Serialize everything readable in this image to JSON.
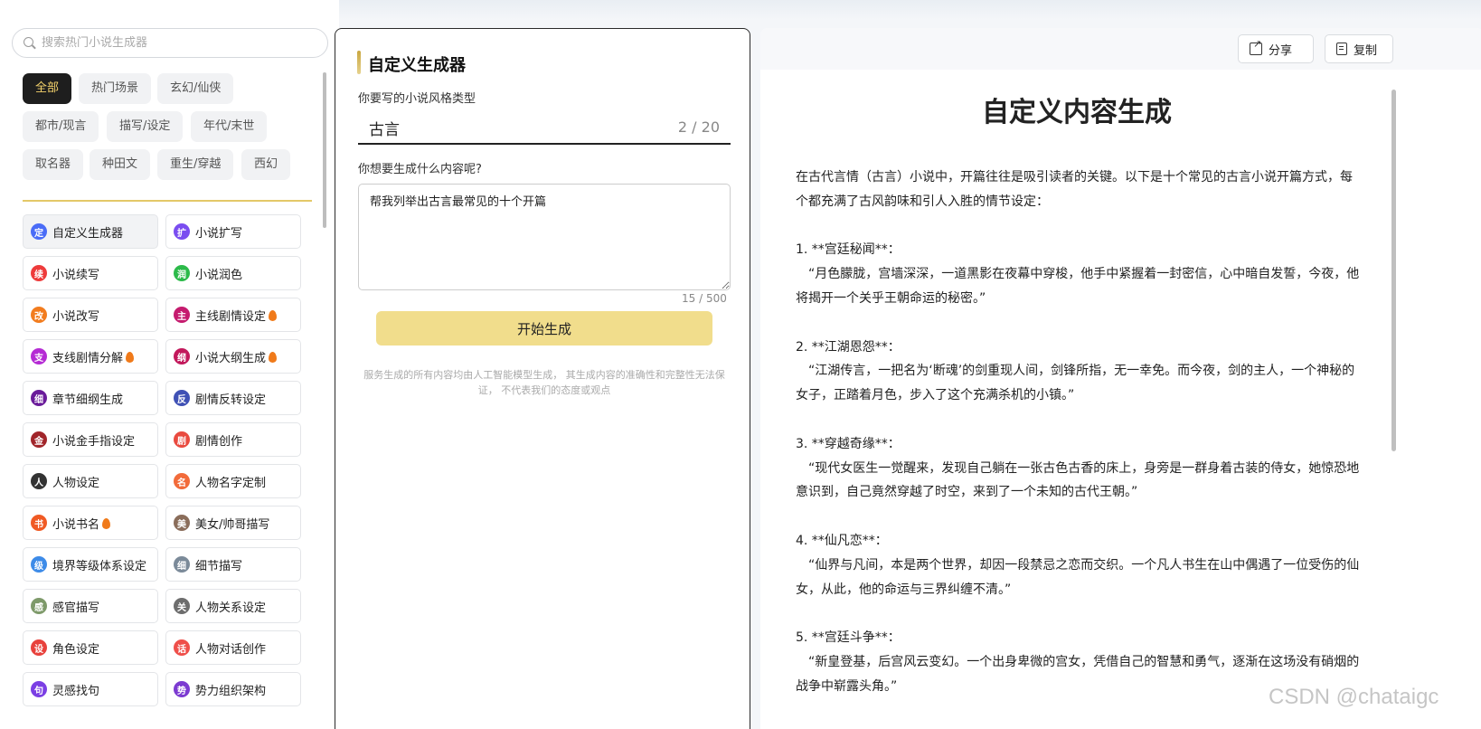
{
  "search": {
    "placeholder": "搜索热门小说生成器"
  },
  "categories": [
    {
      "label": "全部",
      "active": true
    },
    {
      "label": "热门场景"
    },
    {
      "label": "玄幻/仙侠"
    },
    {
      "label": "都市/现言"
    },
    {
      "label": "描写/设定"
    },
    {
      "label": "年代/末世"
    },
    {
      "label": "取名器"
    },
    {
      "label": "种田文"
    },
    {
      "label": "重生/穿越"
    },
    {
      "label": "西幻"
    }
  ],
  "tools": [
    {
      "label": "自定义生成器",
      "icon": "定",
      "color": "#4a6cf7",
      "active": true,
      "hot": false
    },
    {
      "label": "小说扩写",
      "icon": "扩",
      "color": "#7a4df0",
      "hot": false
    },
    {
      "label": "小说续写",
      "icon": "续",
      "color": "#ee3b3b",
      "hot": false
    },
    {
      "label": "小说润色",
      "icon": "润",
      "color": "#2cba4a",
      "hot": false
    },
    {
      "label": "小说改写",
      "icon": "改",
      "color": "#f27c1e",
      "hot": false
    },
    {
      "label": "主线剧情设定",
      "icon": "主",
      "color": "#c51b6e",
      "hot": true
    },
    {
      "label": "支线剧情分解",
      "icon": "支",
      "color": "#b52bd4",
      "hot": true
    },
    {
      "label": "小说大纲生成",
      "icon": "纲",
      "color": "#c2185b",
      "hot": true
    },
    {
      "label": "章节细纲生成",
      "icon": "细",
      "color": "#6a1b9a",
      "hot": false
    },
    {
      "label": "剧情反转设定",
      "icon": "反",
      "color": "#3f51b5",
      "hot": false
    },
    {
      "label": "小说金手指设定",
      "icon": "金",
      "color": "#a1252a",
      "hot": false
    },
    {
      "label": "剧情创作",
      "icon": "剧",
      "color": "#e94a3f",
      "hot": false
    },
    {
      "label": "人物设定",
      "icon": "人",
      "color": "#333333",
      "hot": false
    },
    {
      "label": "人物名字定制",
      "icon": "名",
      "color": "#f26b3a",
      "hot": false
    },
    {
      "label": "小说书名",
      "icon": "书",
      "color": "#f05a24",
      "hot": true
    },
    {
      "label": "美女/帅哥描写",
      "icon": "美",
      "color": "#8a6d5a",
      "hot": false
    },
    {
      "label": "境界等级体系设定",
      "icon": "级",
      "color": "#3d8be8",
      "hot": false
    },
    {
      "label": "细节描写",
      "icon": "细",
      "color": "#7b8a99",
      "hot": false
    },
    {
      "label": "感官描写",
      "icon": "感",
      "color": "#7e9a6a",
      "hot": false
    },
    {
      "label": "人物关系设定",
      "icon": "关",
      "color": "#6d6d6d",
      "hot": false
    },
    {
      "label": "角色设定",
      "icon": "设",
      "color": "#e8413c",
      "hot": false
    },
    {
      "label": "人物对话创作",
      "icon": "话",
      "color": "#ef4f4a",
      "hot": false
    },
    {
      "label": "灵感找句",
      "icon": "句",
      "color": "#7b3fe4",
      "hot": false
    },
    {
      "label": "势力组织架构",
      "icon": "势",
      "color": "#7c3bd1",
      "hot": false
    }
  ],
  "form": {
    "title": "自定义生成器",
    "style_label": "你要写的小说风格类型",
    "style_value": "古言",
    "style_count": "2 / 20",
    "content_label": "你想要生成什么内容呢?",
    "content_value": "帮我列举出古言最常见的十个开篇",
    "content_count": "15 / 500",
    "generate_label": "开始生成",
    "disclaimer": "服务生成的所有内容均由人工智能模型生成， 其生成内容的准确性和完整性无法保证， 不代表我们的态度或观点"
  },
  "result": {
    "share_label": "分享",
    "copy_label": "复制",
    "title": "自定义内容生成",
    "paragraphs": [
      "在古代言情（古言）小说中，开篇往往是吸引读者的关键。以下是十个常见的古言小说开篇方式，每个都充满了古风韵味和引人入胜的情节设定：",
      "",
      "1. **宫廷秘闻**：",
      "　“月色朦胧，宫墙深深，一道黑影在夜幕中穿梭，他手中紧握着一封密信，心中暗自发誓，今夜，他将揭开一个关乎王朝命运的秘密。”",
      "",
      "2. **江湖恩怨**：",
      "　“江湖传言，一把名为‘断魂’的剑重现人间，剑锋所指，无一幸免。而今夜，剑的主人，一个神秘的女子，正踏着月色，步入了这个充满杀机的小镇。”",
      "",
      "3. **穿越奇缘**：",
      "　“现代女医生一觉醒来，发现自己躺在一张古色古香的床上，身旁是一群身着古装的侍女，她惊恐地意识到，自己竟然穿越了时空，来到了一个未知的古代王朝。”",
      "",
      "4. **仙凡恋**：",
      "　“仙界与凡间，本是两个世界，却因一段禁忌之恋而交织。一个凡人书生在山中偶遇了一位受伤的仙女，从此，他的命运与三界纠缠不清。”",
      "",
      "5. **宫廷斗争**：",
      "　“新皇登基，后宫风云变幻。一个出身卑微的宫女，凭借自己的智慧和勇气，逐渐在这场没有硝烟的战争中崭露头角。”"
    ]
  },
  "watermark": "CSDN @chataigc"
}
